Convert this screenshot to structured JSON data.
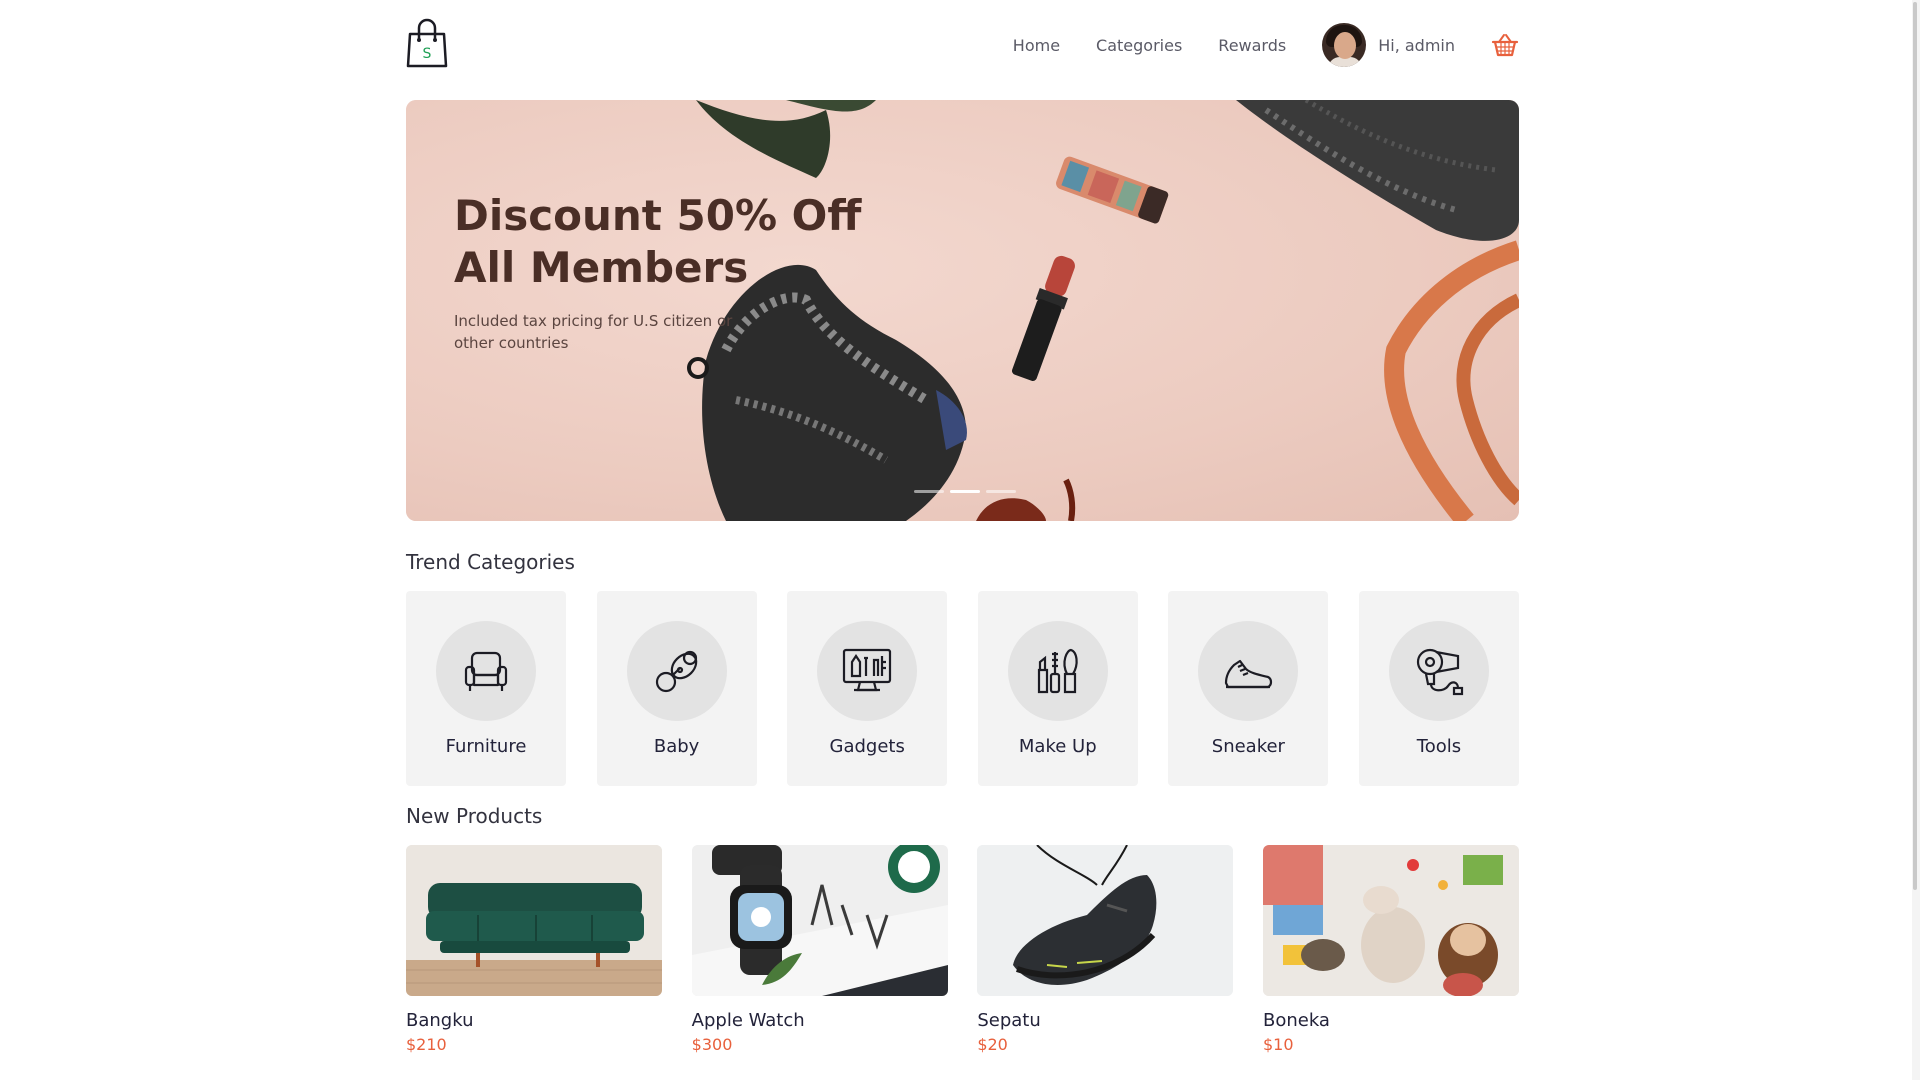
{
  "header": {
    "nav": [
      "Home",
      "Categories",
      "Rewards"
    ],
    "user_greeting": "Hi, admin",
    "logo_letter": "S"
  },
  "hero": {
    "title_line1": "Discount 50% Off",
    "title_line2": "All Members",
    "subtitle": "Included tax pricing for U.S citizen or other countries",
    "slides": 3,
    "active_slide": 2
  },
  "trend": {
    "title": "Trend Categories",
    "items": [
      {
        "label": "Furniture",
        "icon": "armchair-icon"
      },
      {
        "label": "Baby",
        "icon": "pacifier-icon"
      },
      {
        "label": "Gadgets",
        "icon": "monitor-icon"
      },
      {
        "label": "Make Up",
        "icon": "makeup-icon"
      },
      {
        "label": "Sneaker",
        "icon": "sneaker-icon"
      },
      {
        "label": "Tools",
        "icon": "hair-dryer-icon"
      }
    ]
  },
  "products": {
    "title": "New Products",
    "items": [
      {
        "name": "Bangku",
        "price": "$210"
      },
      {
        "name": "Apple Watch",
        "price": "$300"
      },
      {
        "name": "Sepatu",
        "price": "$20"
      },
      {
        "name": "Boneka",
        "price": "$10"
      }
    ]
  },
  "colors": {
    "accent": "#e8603c",
    "hero_bg": "#efd0c6",
    "hero_title": "#4a2e26"
  }
}
